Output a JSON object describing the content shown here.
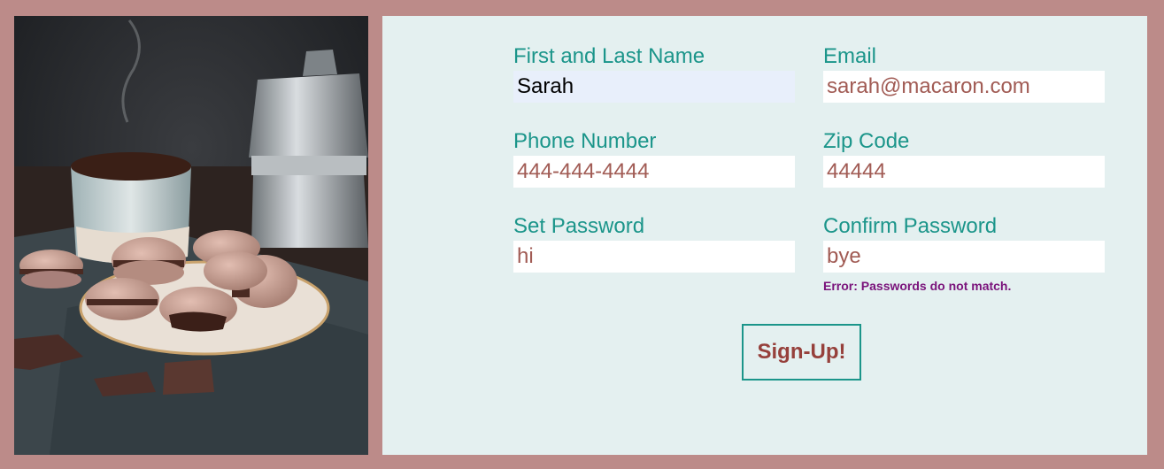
{
  "form": {
    "fields": [
      {
        "label": "First and Last Name",
        "value": "Sarah"
      },
      {
        "label": "Email",
        "value": "sarah@macaron.com"
      },
      {
        "label": "Phone Number",
        "value": "444-444-4444"
      },
      {
        "label": "Zip Code",
        "value": "44444"
      },
      {
        "label": "Set Password",
        "value": "hi"
      },
      {
        "label": "Confirm Password",
        "value": "bye"
      }
    ],
    "error": "Error: Passwords do not match.",
    "submit_label": "Sign-Up!"
  },
  "colors": {
    "border": "#bc8b89",
    "panel": "#e4f0f0",
    "label": "#1b958a",
    "input_text": "#a15b54",
    "error": "#7a137b",
    "button_text": "#96403b"
  }
}
